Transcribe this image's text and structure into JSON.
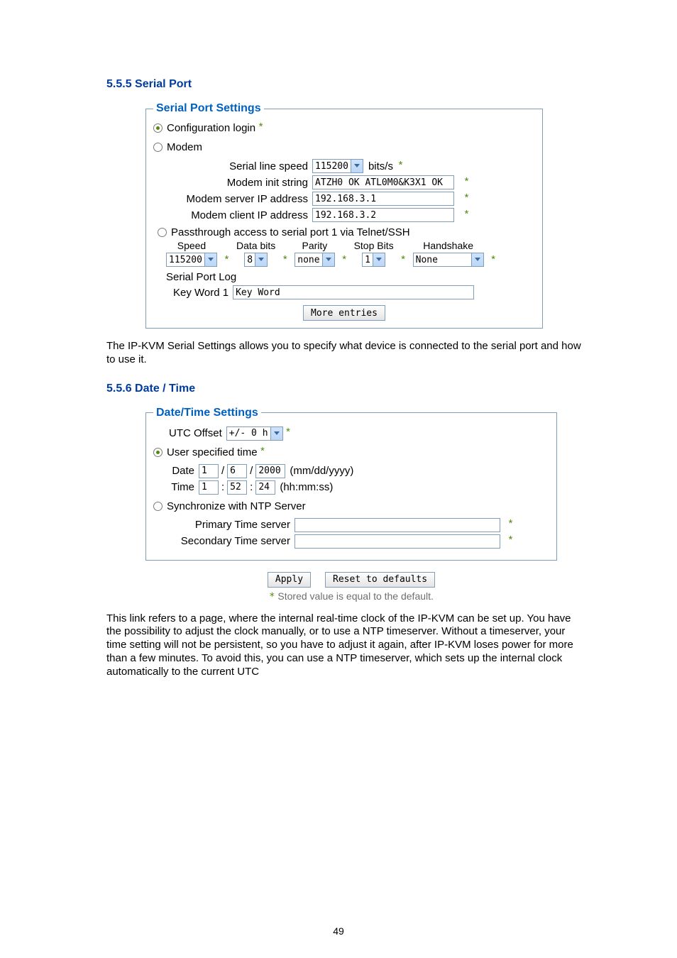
{
  "page_number": "49",
  "section_serial": {
    "heading": "5.5.5 Serial Port",
    "legend": "Serial Port Settings",
    "opt_config_login": "Configuration login",
    "opt_modem": "Modem",
    "modem_fields": {
      "serial_line_speed_label": "Serial line speed",
      "serial_line_speed_value": "115200",
      "serial_line_speed_unit": "bits/s",
      "modem_init_string_label": "Modem init string",
      "modem_init_string_value": "ATZH0 OK ATL0M0&K3X1 OK",
      "modem_server_ip_label": "Modem server IP address",
      "modem_server_ip_value": "192.168.3.1",
      "modem_client_ip_label": "Modem client IP address",
      "modem_client_ip_value": "192.168.3.2"
    },
    "opt_passthrough": "Passthrough access to serial port 1 via Telnet/SSH",
    "pass_headers": {
      "speed": "Speed",
      "databits": "Data bits",
      "parity": "Parity",
      "stopbits": "Stop Bits",
      "handshake": "Handshake"
    },
    "pass_values": {
      "speed": "115200",
      "databits": "8",
      "parity": "none",
      "stopbits": "1",
      "handshake": "None"
    },
    "serial_port_log_label": "Serial Port Log",
    "keyword1_label": "Key Word 1",
    "keyword1_value": "Key Word",
    "more_entries_btn": "More entries"
  },
  "serial_paragraph": "The IP-KVM Serial Settings allows you to specify what device is connected to the serial port and how to use it.",
  "section_datetime": {
    "heading": "5.5.6 Date / Time",
    "legend": "Date/Time Settings",
    "utc_offset_label": "UTC Offset",
    "utc_offset_value": "+/- 0 h",
    "opt_user_time": "User specified time",
    "date_label": "Date",
    "date_mm": "1",
    "date_dd": "6",
    "date_yyyy": "2000",
    "date_hint": "(mm/dd/yyyy)",
    "time_label": "Time",
    "time_hh": "1",
    "time_mm": "52",
    "time_ss": "24",
    "time_hint": "(hh:mm:ss)",
    "opt_ntp": "Synchronize with NTP Server",
    "primary_label": "Primary Time server",
    "secondary_label": "Secondary Time server",
    "apply_btn": "Apply",
    "reset_btn": "Reset to defaults",
    "footnote": "Stored value is equal to the default."
  },
  "datetime_paragraph": "This link refers to a page, where the internal real-time clock of the IP-KVM can be set up. You have the possibility to adjust the clock manually, or to use a NTP timeserver. Without a timeserver, your time setting will not be persistent, so you have to adjust it again, after IP-KVM loses power for more than a few minutes. To avoid this, you can use a NTP timeserver, which sets up the internal clock automatically to the current UTC"
}
